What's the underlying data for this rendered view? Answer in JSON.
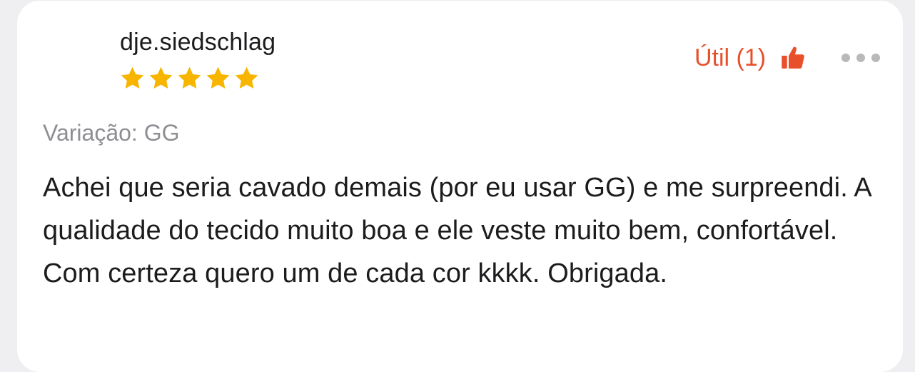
{
  "review": {
    "username": "dje.siedschlag",
    "rating": 5,
    "rating_max": 5,
    "helpful_label": "Útil (1)",
    "variation": "Variação: GG",
    "text": "Achei que seria cavado demais (por eu usar GG) e me surpreendi. A qualidade do tecido muito boa e ele veste muito bem, confortável. Com certeza quero um de cada cor kkkk. Obrigada."
  },
  "icons": {
    "star": "star-icon",
    "thumb": "thumbs-up-icon",
    "more": "more-options-icon"
  },
  "colors": {
    "accent": "#e8502c",
    "star": "#f7b500",
    "muted": "#8e8e93",
    "text": "#1c1c1e",
    "background": "#efeff1",
    "card": "#ffffff"
  }
}
